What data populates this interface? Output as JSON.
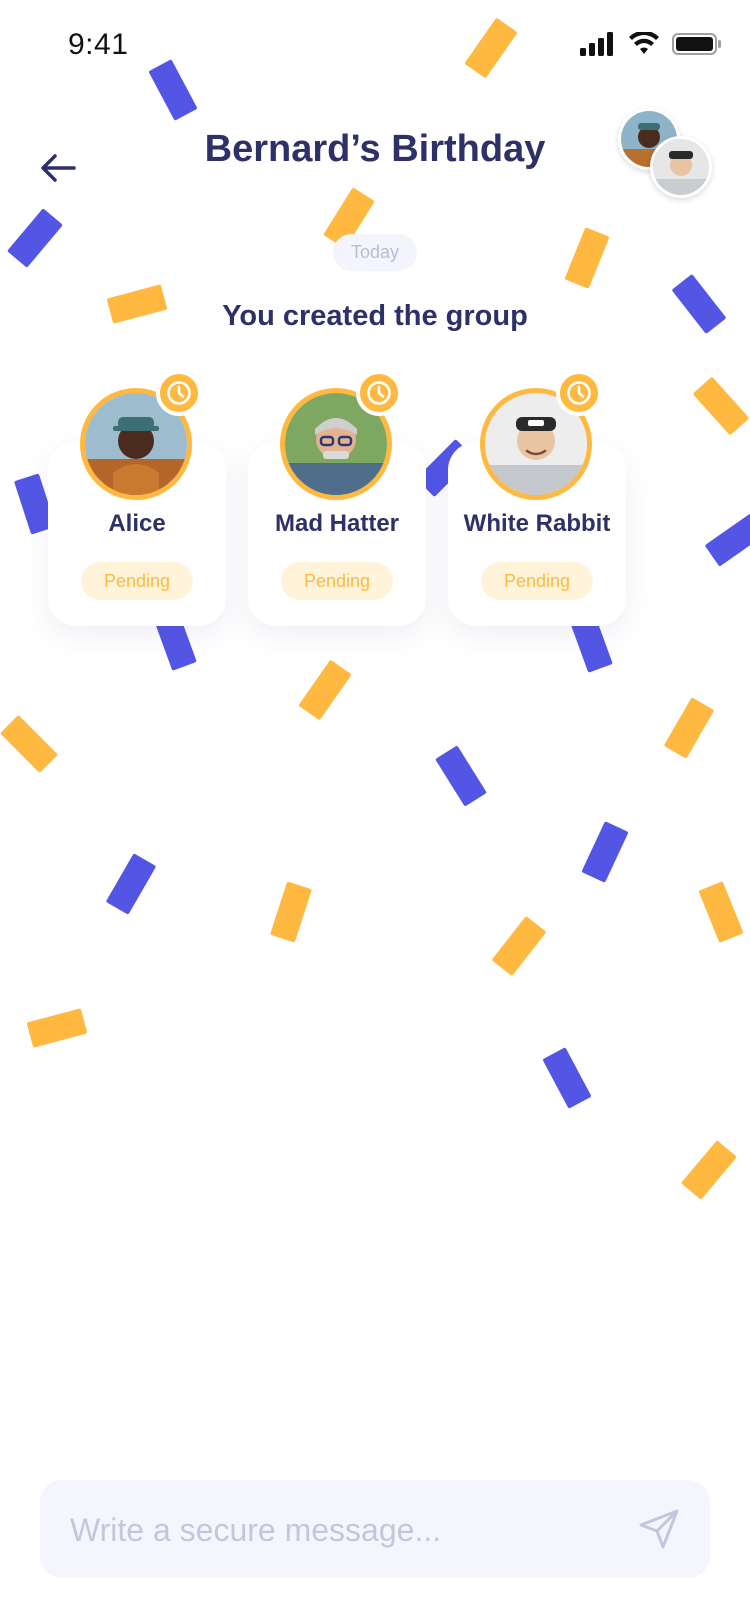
{
  "status_bar": {
    "time": "9:41"
  },
  "header": {
    "title": "Bernard’s Birthday"
  },
  "chat": {
    "date_label": "Today",
    "event_text": "You created the group"
  },
  "members": [
    {
      "name": "Alice",
      "status": "Pending"
    },
    {
      "name": "Mad Hatter",
      "status": "Pending"
    },
    {
      "name": "White Rabbit",
      "status": "Pending"
    }
  ],
  "composer": {
    "placeholder": "Write a secure message..."
  },
  "colors": {
    "accent_yellow": "#FFB940",
    "accent_blue": "#5356E5",
    "text_primary": "#2E3167"
  },
  "icons": [
    "back-arrow-icon",
    "clock-icon",
    "send-icon",
    "signal-icon",
    "wifi-icon",
    "battery-icon"
  ]
}
